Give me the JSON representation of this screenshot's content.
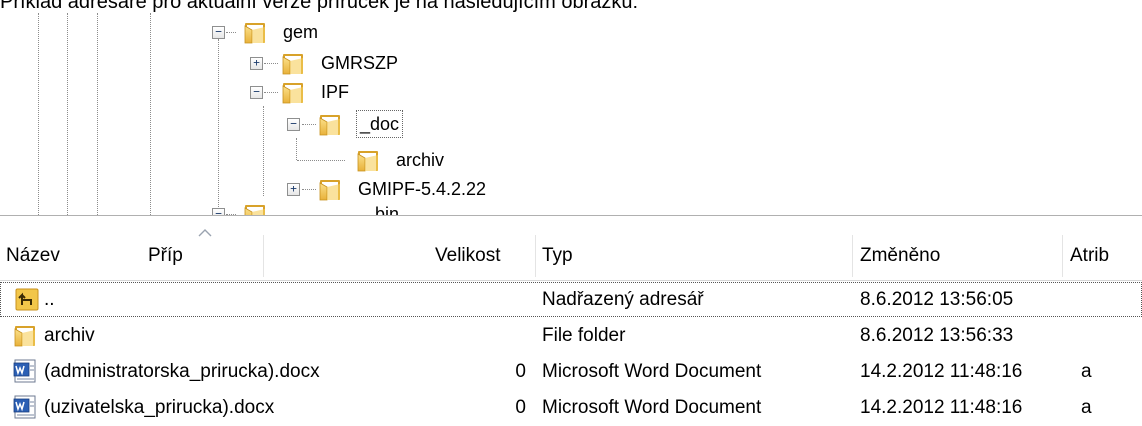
{
  "caption": "Příklad adresáře pro aktuální verze příruček je na následujícím obrázku:",
  "tree": {
    "nodes": [
      {
        "label": "gem",
        "expander": "−"
      },
      {
        "label": "GMRSZP",
        "expander": "+"
      },
      {
        "label": "IPF",
        "expander": "−"
      },
      {
        "label": "_doc",
        "expander": "−"
      },
      {
        "label": "archiv",
        "expander": ""
      },
      {
        "label": "GMIPF-5.4.2.22",
        "expander": "+"
      },
      {
        "label": "...bin",
        "expander": "−"
      }
    ]
  },
  "columns": {
    "name": "Název",
    "ext": "Příp",
    "size": "Velikost",
    "type": "Typ",
    "modified": "Změněno",
    "attr": "Atrib"
  },
  "files": [
    {
      "icon": "parent-folder-icon",
      "name": "..",
      "size": "",
      "type": "Nadřazený adresář",
      "modified": "8.6.2012 13:56:05",
      "attr": ""
    },
    {
      "icon": "folder-icon",
      "name": "archiv",
      "size": "",
      "type": "File folder",
      "modified": "8.6.2012 13:56:33",
      "attr": ""
    },
    {
      "icon": "word-document-icon",
      "name": "(administratorska_prirucka).docx",
      "size": "0",
      "type": "Microsoft Word Document",
      "modified": "14.2.2012 11:48:16",
      "attr": "a"
    },
    {
      "icon": "word-document-icon",
      "name": "(uzivatelska_prirucka).docx",
      "size": "0",
      "type": "Microsoft Word Document",
      "modified": "14.2.2012 11:48:16",
      "attr": "a"
    }
  ],
  "colors": {
    "folder": "#f2c64a",
    "folder_dark": "#d8a22a",
    "word_blue": "#2b5fb4"
  }
}
